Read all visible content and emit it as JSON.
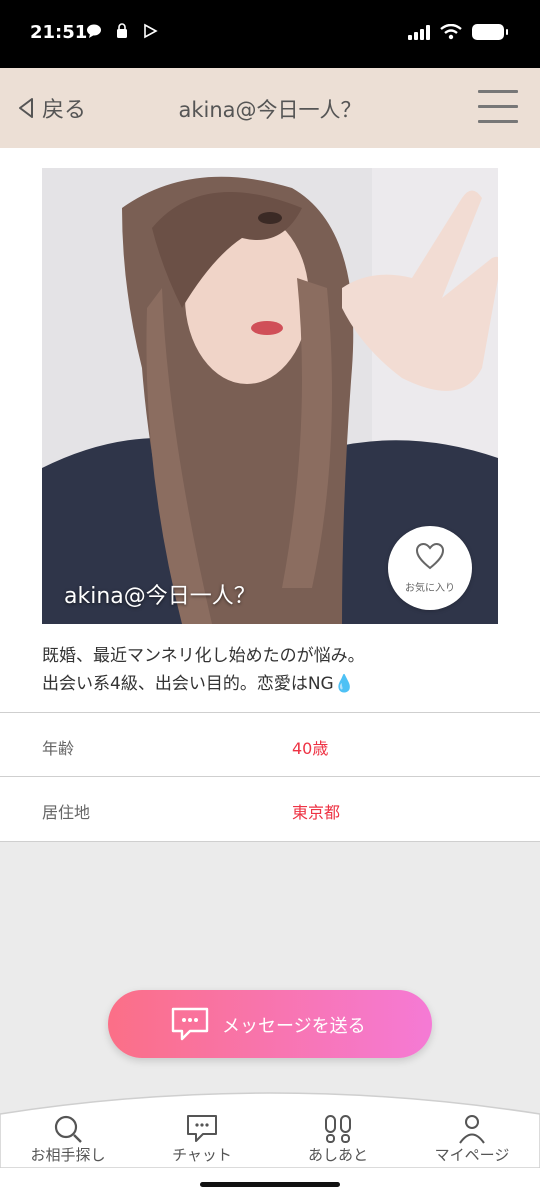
{
  "status_bar": {
    "time": "21:51"
  },
  "header": {
    "back_label": "戻る",
    "title": "akina@今日一人？"
  },
  "profile": {
    "photo_name": "akina@今日一人？",
    "favorite_label": "お気に入り",
    "intro_line1": "既婚、最近マンネリ化し始めたのが悩み。",
    "intro_line2": "出会い系4級、出会い目的。恋愛はNG💧",
    "details": [
      {
        "label": "年齢",
        "value": "40歳"
      },
      {
        "label": "居住地",
        "value": "東京都"
      }
    ]
  },
  "message_button": {
    "label": "メッセージを送る"
  },
  "bottom_nav": [
    {
      "label": "お相手探し",
      "icon": "search-icon"
    },
    {
      "label": "チャット",
      "icon": "chat-icon"
    },
    {
      "label": "あしあと",
      "icon": "footprints-icon"
    },
    {
      "label": "マイページ",
      "icon": "person-icon"
    }
  ],
  "colors": {
    "header_bg": "#ecdfd5",
    "accent_red": "#ee3344",
    "button_start": "#fb6f87",
    "button_end": "#f57ad5"
  }
}
